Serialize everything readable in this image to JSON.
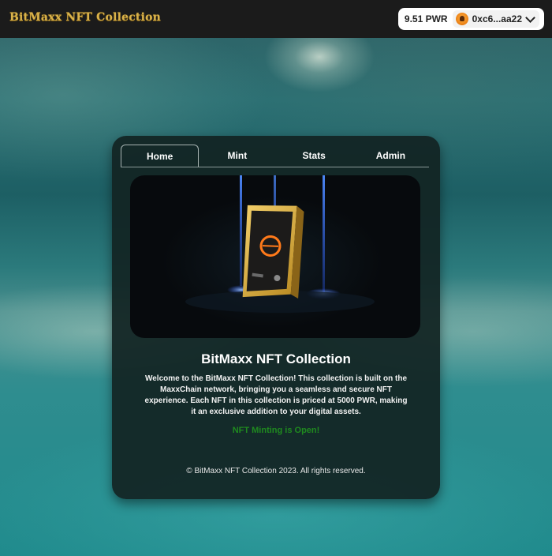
{
  "header": {
    "brand": "BitMaxx NFT Collection",
    "wallet": {
      "balance": "9.51 PWR",
      "address": "0xc6...aa22"
    }
  },
  "tabs": [
    {
      "label": "Home",
      "active": true
    },
    {
      "label": "Mint",
      "active": false
    },
    {
      "label": "Stats",
      "active": false
    },
    {
      "label": "Admin",
      "active": false
    }
  ],
  "main": {
    "title": "BitMaxx NFT Collection",
    "description": "Welcome to the BitMaxx NFT Collection! This collection is built on the MaxxChain network, bringing you a seamless and secure NFT experience. Each NFT in this collection is priced at 5000 PWR, making it an exclusive addition to your digital assets.",
    "status": "NFT Minting is Open!",
    "footer": "© BitMaxx NFT Collection 2023. All rights reserved."
  },
  "colors": {
    "brand_gold": "#d9b24a",
    "status_green": "#1f8a1f",
    "card_bg": "#122422",
    "header_bg": "#1b1b1b"
  }
}
